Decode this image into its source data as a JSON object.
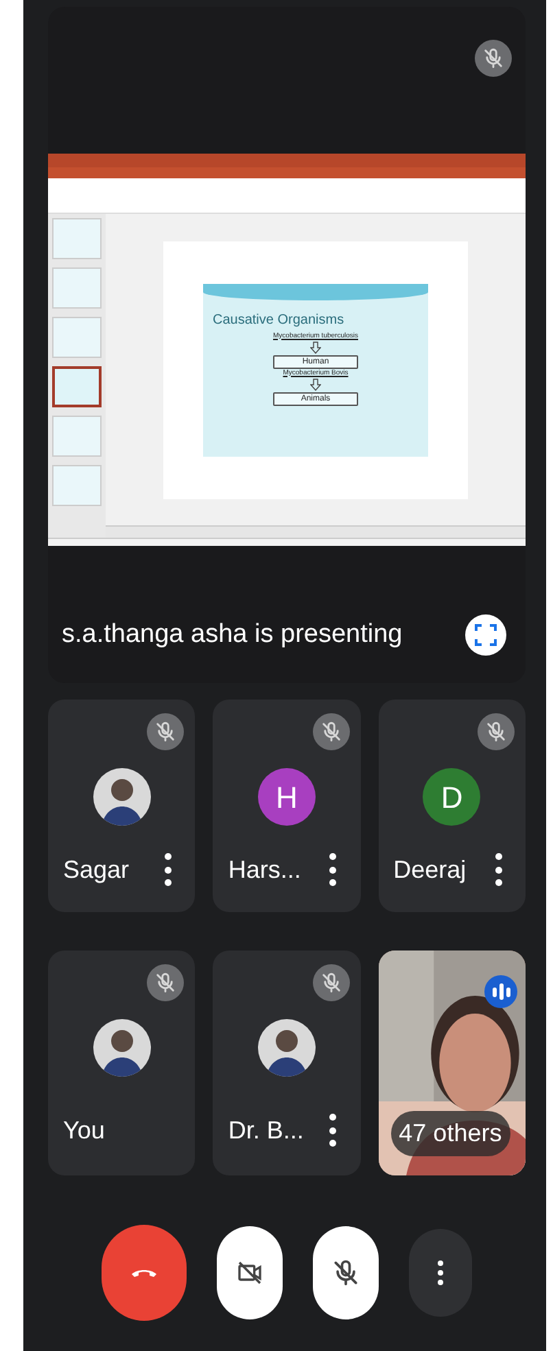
{
  "presentation": {
    "muted": true,
    "caption": "s.a.thanga asha is presenting",
    "shared_screen": {
      "thumbnails": [
        {
          "selected": false
        },
        {
          "selected": false
        },
        {
          "selected": false
        },
        {
          "selected": true
        },
        {
          "selected": false
        },
        {
          "selected": false
        }
      ],
      "slide": {
        "title": "Causative Organisms",
        "items": [
          {
            "kind": "label",
            "text": "Mycobacterium tuberculosis"
          },
          {
            "kind": "arrow"
          },
          {
            "kind": "box",
            "text": "Human"
          },
          {
            "kind": "label",
            "text": "Mycobacterium Bovis"
          },
          {
            "kind": "arrow"
          },
          {
            "kind": "box",
            "text": "Animals"
          }
        ]
      }
    }
  },
  "participants": [
    {
      "name": "Sagar",
      "muted": true,
      "menu": true
    },
    {
      "name": "Hars...",
      "kind": "letter",
      "initial": "H",
      "color": "#a83fc0",
      "muted": true,
      "menu": true
    },
    {
      "name": "Deeraj",
      "kind": "letter",
      "initial": "D",
      "color": "#2e7d32",
      "muted": true,
      "menu": true
    },
    {
      "name": "You",
      "muted": true,
      "menu": false
    },
    {
      "name": "Dr. B...",
      "muted": true,
      "menu": true
    },
    {
      "name": "47 others",
      "kind": "video",
      "speaking": true
    }
  ],
  "controls": [
    {
      "kind": "hangup"
    },
    {
      "kind": "camera",
      "on": false
    },
    {
      "kind": "mic",
      "on": false
    },
    {
      "kind": "more"
    }
  ]
}
